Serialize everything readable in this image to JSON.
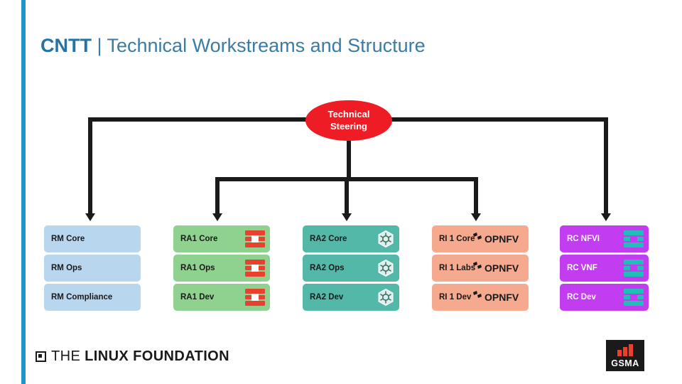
{
  "title": {
    "bold": "CNTT",
    "rest": " | Technical Workstreams and Structure"
  },
  "steering": {
    "line1": "Technical",
    "line2": "Steering"
  },
  "columns": [
    {
      "name": "rm",
      "color": "#b9d6ef",
      "logo": "none",
      "items": [
        {
          "label": "RM Core"
        },
        {
          "label": "RM Ops"
        },
        {
          "label": "RM Compliance"
        }
      ]
    },
    {
      "name": "ra1",
      "color": "#8fd18f",
      "logo": "openstack-icon",
      "items": [
        {
          "label": "RA1 Core"
        },
        {
          "label": "RA1 Ops"
        },
        {
          "label": "RA1 Dev"
        }
      ]
    },
    {
      "name": "ra2",
      "color": "#53b8a8",
      "logo": "kubernetes-icon",
      "items": [
        {
          "label": "RA2 Core"
        },
        {
          "label": "RA2 Ops"
        },
        {
          "label": "RA2 Dev"
        }
      ]
    },
    {
      "name": "ri1",
      "color": "#f5a98e",
      "logo": "opnfv-icon",
      "logo_text": "OPNFV",
      "items": [
        {
          "label": "RI 1 Core"
        },
        {
          "label": "RI 1 Labs"
        },
        {
          "label": "RI 1 Dev"
        }
      ]
    },
    {
      "name": "rc",
      "color": "#c23df0",
      "logo": "openstack-icon",
      "items": [
        {
          "label": "RC NFVI"
        },
        {
          "label": "RC VNF"
        },
        {
          "label": "RC Dev"
        }
      ]
    }
  ],
  "footer": {
    "linux_foundation_the": "THE ",
    "linux_foundation_name": "LINUX FOUNDATION",
    "gsma_name": "GSMA"
  }
}
